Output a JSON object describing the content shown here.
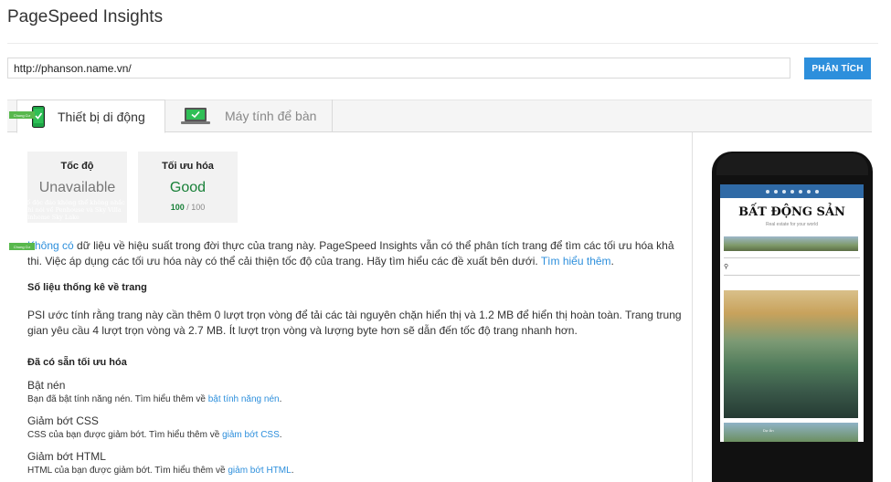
{
  "app": {
    "title": "PageSpeed Insights"
  },
  "search": {
    "url_value": "http://phanson.name.vn/",
    "analyze_label": "PHÂN TÍCH"
  },
  "tabs": [
    {
      "label": "Thiết bị di động",
      "icon": "mobile-phone-icon",
      "active": true
    },
    {
      "label": "Máy tính để bàn",
      "icon": "desktop-laptop-icon",
      "active": false
    }
  ],
  "scores": {
    "speed": {
      "label": "Tốc độ",
      "value": "Unavailable"
    },
    "optimization": {
      "label": "Tối ưu hóa",
      "value": "Good",
      "score": "100",
      "max": "/ 100"
    }
  },
  "summary": {
    "link1": "Không có",
    "text": " dữ liệu về hiệu suất trong đời thực của trang này. PageSpeed Insights vẫn có thể phân tích trang để tìm các tối ưu hóa khả thi. Việc áp dụng các tối ưu hóa này có thể cải thiện tốc độ của trang. Hãy tìm hiểu các đề xuất bên dưới. ",
    "link2": "Tìm hiểu thêm",
    "end": "."
  },
  "stats": {
    "heading": "Số liệu thống kê về trang",
    "text": "PSI ước tính rằng trang này cần thêm 0 lượt trọn vòng để tải các tài nguyên chặn hiển thị và 1.2 MB để hiển thị hoàn toàn. Trang trung gian yêu cầu 4 lượt trọn vòng và 2.7 MB. Ít lượt trọn vòng và lượng byte hơn sẽ dẫn đến tốc độ trang nhanh hơn."
  },
  "optimizations": {
    "heading": "Đã có sẵn tối ưu hóa",
    "items": [
      {
        "title": "Bật nén",
        "desc": "Bạn đã bật tính năng nén. Tìm hiểu thêm về ",
        "link": "bật tính năng nén",
        "end": "."
      },
      {
        "title": "Giảm bớt CSS",
        "desc": "CSS của bạn được giảm bớt. Tìm hiểu thêm về ",
        "link": "giảm bớt CSS",
        "end": "."
      },
      {
        "title": "Giảm bớt HTML",
        "desc": "HTML của bạn được giảm bớt. Tìm hiểu thêm về ",
        "link": "giảm bớt HTML",
        "end": "."
      }
    ]
  },
  "preview": {
    "brand": "BẤT ĐỘNG SẢN",
    "tagline": "Real estate for your world",
    "category": "Chung Cư",
    "headline": "Yếu tố độc đáo không thể không nhắc đến khi nói về Penhouse và Sky Villa của Vinhome Sky Lake",
    "category2": "Chung Cư",
    "category2_extra": "Dự Án"
  },
  "colors": {
    "accent": "#2d8fdc",
    "good": "#188038",
    "phone_green": "#1ea446"
  }
}
